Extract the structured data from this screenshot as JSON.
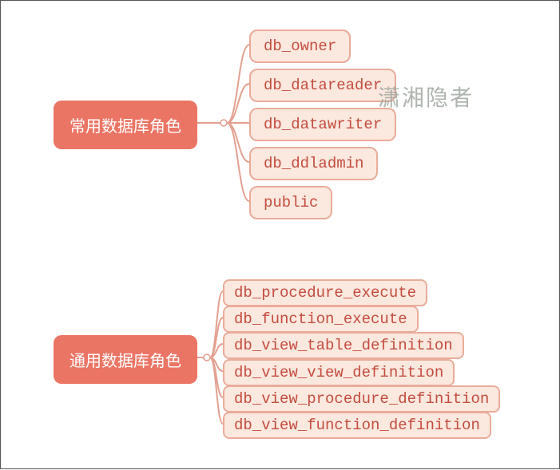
{
  "watermark": "潇湘隐者",
  "groups": [
    {
      "title": "常用数据库角色",
      "children": [
        "db_owner",
        "db_datareader",
        "db_datawriter",
        "db_ddladmin",
        "public"
      ]
    },
    {
      "title": "通用数据库角色",
      "children": [
        "db_procedure_execute",
        "db_function_execute",
        "db_view_table_definition",
        "db_view_view_definition",
        "db_view_procedure_definition",
        "db_view_function_definition"
      ]
    }
  ]
}
